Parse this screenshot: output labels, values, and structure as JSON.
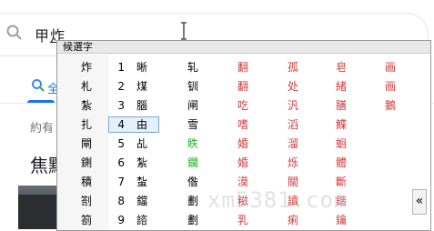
{
  "search": {
    "typed": "甲",
    "composing": "炸"
  },
  "page": {
    "tab_all": "全",
    "results_count": "約有",
    "section_title": "焦點"
  },
  "ime": {
    "title": "候選字",
    "rows": [
      {
        "left": "炸",
        "num": "1",
        "cand": "晰",
        "c3": "轧",
        "c4": "翻",
        "c5": "孤",
        "c6": "皂",
        "c7": "画"
      },
      {
        "left": "札",
        "num": "2",
        "cand": "煤",
        "c3": "钏",
        "c4": "翻",
        "c5": "处",
        "c6": "緒",
        "c7": "画"
      },
      {
        "left": "紮",
        "num": "3",
        "cand": "腦",
        "c3": "闸",
        "c4": "吃",
        "c5": "汎",
        "c6": "膳",
        "c7": "鵝"
      },
      {
        "left": "扎",
        "num": "4",
        "cand": "由",
        "c3": "雪",
        "c4": "嗜",
        "c5": "滔",
        "c6": "鰈",
        "c7": ""
      },
      {
        "left": "閘",
        "num": "5",
        "cand": "乩",
        "c3": "眣",
        "c4": "婚",
        "c5": "溜",
        "c6": "蛔",
        "c7": ""
      },
      {
        "left": "鍘",
        "num": "6",
        "cand": "紮",
        "c3": "鑭",
        "c4": "婚",
        "c5": "烁",
        "c6": "體",
        "c7": ""
      },
      {
        "left": "積",
        "num": "7",
        "cand": "蚻",
        "c3": "偺",
        "c4": "漠",
        "c5": "關",
        "c6": "斷",
        "c7": ""
      },
      {
        "left": "劄",
        "num": "8",
        "cand": "鐺",
        "c3": "劃",
        "c4": "糍",
        "c5": "讀",
        "c6": "鍇",
        "c7": ""
      },
      {
        "left": "箚",
        "num": "9",
        "cand": "諮",
        "c3": "劃",
        "c4": "乳",
        "c5": "痢",
        "c6": "鑰",
        "c7": ""
      }
    ],
    "selected_index": 3
  },
  "watermark": "xm5381.com",
  "scroll_label": "«",
  "colors": {
    "accent": "#1a73e8",
    "candidate_red": "#d43c3c",
    "candidate_green": "#2bb02b"
  }
}
